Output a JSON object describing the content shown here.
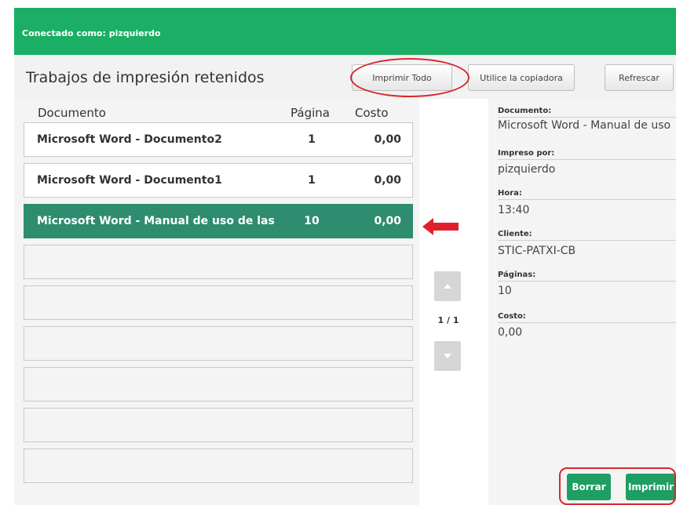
{
  "topbar": {
    "user_label": "Conectado como: pizquierdo",
    "color": "#1aaf64"
  },
  "header": {
    "title": "Trabajos de impresión retenidos",
    "buttons": {
      "print_all": "Imprimir Todo",
      "use_copier": "Utilice la copiadora",
      "refresh": "Refrescar"
    }
  },
  "table": {
    "columns": {
      "document": "Documento",
      "pages": "Página",
      "cost": "Costo"
    },
    "rows": [
      {
        "document": "Microsoft Word - Documento2",
        "pages": "1",
        "cost": "0,00",
        "selected": false
      },
      {
        "document": "Microsoft Word - Documento1",
        "pages": "1",
        "cost": "0,00",
        "selected": false
      },
      {
        "document": "Microsoft Word - Manual de uso de las",
        "pages": "10",
        "cost": "0,00",
        "selected": true
      }
    ],
    "selected_color": "#2e8c6f"
  },
  "pager": {
    "label": "1 / 1"
  },
  "details": {
    "document_label": "Documento:",
    "document_value": "Microsoft Word - Manual de uso",
    "printed_by_label": "Impreso por:",
    "printed_by_value": "pizquierdo",
    "time_label": "Hora:",
    "time_value": "13:40",
    "client_label": "Cliente:",
    "client_value": "STIC-PATXI-CB",
    "pages_label": "Páginas:",
    "pages_value": "10",
    "cost_label": "Costo:",
    "cost_value": "0,00"
  },
  "actions": {
    "delete": "Borrar",
    "print": "Imprimir"
  },
  "annotation_color": "#d9272e"
}
